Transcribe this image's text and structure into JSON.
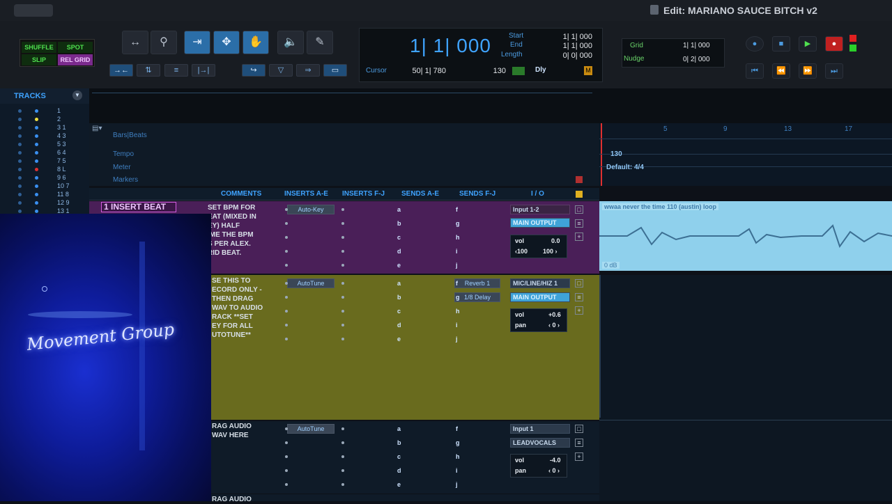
{
  "window": {
    "title": "Edit: MARIANO SAUCE BITCH v2"
  },
  "edit_modes": {
    "shuffle": "SHUFFLE",
    "spot": "SPOT",
    "slip": "SLIP",
    "grid": "REL GRID"
  },
  "counter": {
    "main": "1| 1| 000",
    "start_label": "Start",
    "start": "1| 1| 000",
    "end_label": "End",
    "end": "1| 1| 000",
    "length_label": "Length",
    "length": "0| 0| 000",
    "cursor_label": "Cursor",
    "cursor": "50| 1| 780",
    "tempo": "130",
    "dly_label": "Dly"
  },
  "grid": {
    "grid_label": "Grid",
    "grid_value": "1| 1| 000",
    "nudge_label": "Nudge",
    "nudge_value": "0| 2| 000"
  },
  "tracks_panel": {
    "title": "TRACKS",
    "rows": [
      {
        "label": "1",
        "color": "#3a8ff0"
      },
      {
        "label": "2",
        "color": "#f0e040"
      },
      {
        "label": "3 1",
        "color": "#3a8ff0"
      },
      {
        "label": "4 3",
        "color": "#3a8ff0"
      },
      {
        "label": "5 3",
        "color": "#3a8ff0"
      },
      {
        "label": "6 4",
        "color": "#3a8ff0"
      },
      {
        "label": "7 5",
        "color": "#3a8ff0"
      },
      {
        "label": "8 L",
        "color": "#e03030"
      },
      {
        "label": "9 6",
        "color": "#3a8ff0"
      },
      {
        "label": "10 7",
        "color": "#3a8ff0"
      },
      {
        "label": "11 8",
        "color": "#3a8ff0"
      },
      {
        "label": "12 9",
        "color": "#3a8ff0"
      },
      {
        "label": "13 1",
        "color": "#3a8ff0"
      }
    ]
  },
  "rulers": {
    "bars_beats": "Bars|Beats",
    "tempo": "Tempo",
    "meter": "Meter",
    "markers": "Markers",
    "tempo_value": "130",
    "meter_value": "Default: 4/4"
  },
  "timeline_ticks": [
    "5",
    "9",
    "13",
    "17"
  ],
  "columns": {
    "comments": "COMMENTS",
    "inserts_ae": "INSERTS A-E",
    "inserts_fj": "INSERTS F-J",
    "sends_ae": "SENDS A-E",
    "sends_fj": "SENDS F-J",
    "io": "I / O"
  },
  "track1": {
    "name": "1 INSERT BEAT",
    "comment": "SET BPM FOR\nEAT (MIXED IN\nEY) HALF\nIME THE BPM\nS PER ALEX.\nRID BEAT.",
    "insert": "Auto-Key",
    "input": "Input 1-2",
    "output": "MAIN OUTPUT",
    "vol_label": "vol",
    "vol": "0.0",
    "pan_left": "‹100",
    "pan_right": "100 ›",
    "clip_name": "wwaa never the time 110 (austin) loop",
    "clip_gain": "0 dB"
  },
  "track2": {
    "comment": "SE THIS TO\nECORD ONLY -\nTHEN DRAG\nWAV TO AUDIO\nRACK **SET\nEY FOR ALL\nUTOTUNE**",
    "insert": "AutoTune",
    "send_f": "Reverb 1",
    "send_g": "1/8 Delay",
    "input": "MIC/LINE/HIZ 1",
    "output": "MAIN OUTPUT",
    "vol_label": "vol",
    "vol": "+0.6",
    "pan_label": "pan",
    "pan": "‹ 0 ›"
  },
  "track3": {
    "comment": "RAG AUDIO\nWAV HERE",
    "insert": "AutoTune",
    "input": "Input 1",
    "output": "LEADVOCALS",
    "vol_label": "vol",
    "vol": "-4.0",
    "pan_label": "pan",
    "pan": "‹ 0 ›"
  },
  "track4": {
    "comment": "RAG AUDIO"
  },
  "sends_ae": [
    "a",
    "b",
    "c",
    "d",
    "e"
  ],
  "sends_fj": [
    "f",
    "g",
    "h",
    "i",
    "j"
  ],
  "webcam": {
    "neon_text": "Movement Group"
  }
}
